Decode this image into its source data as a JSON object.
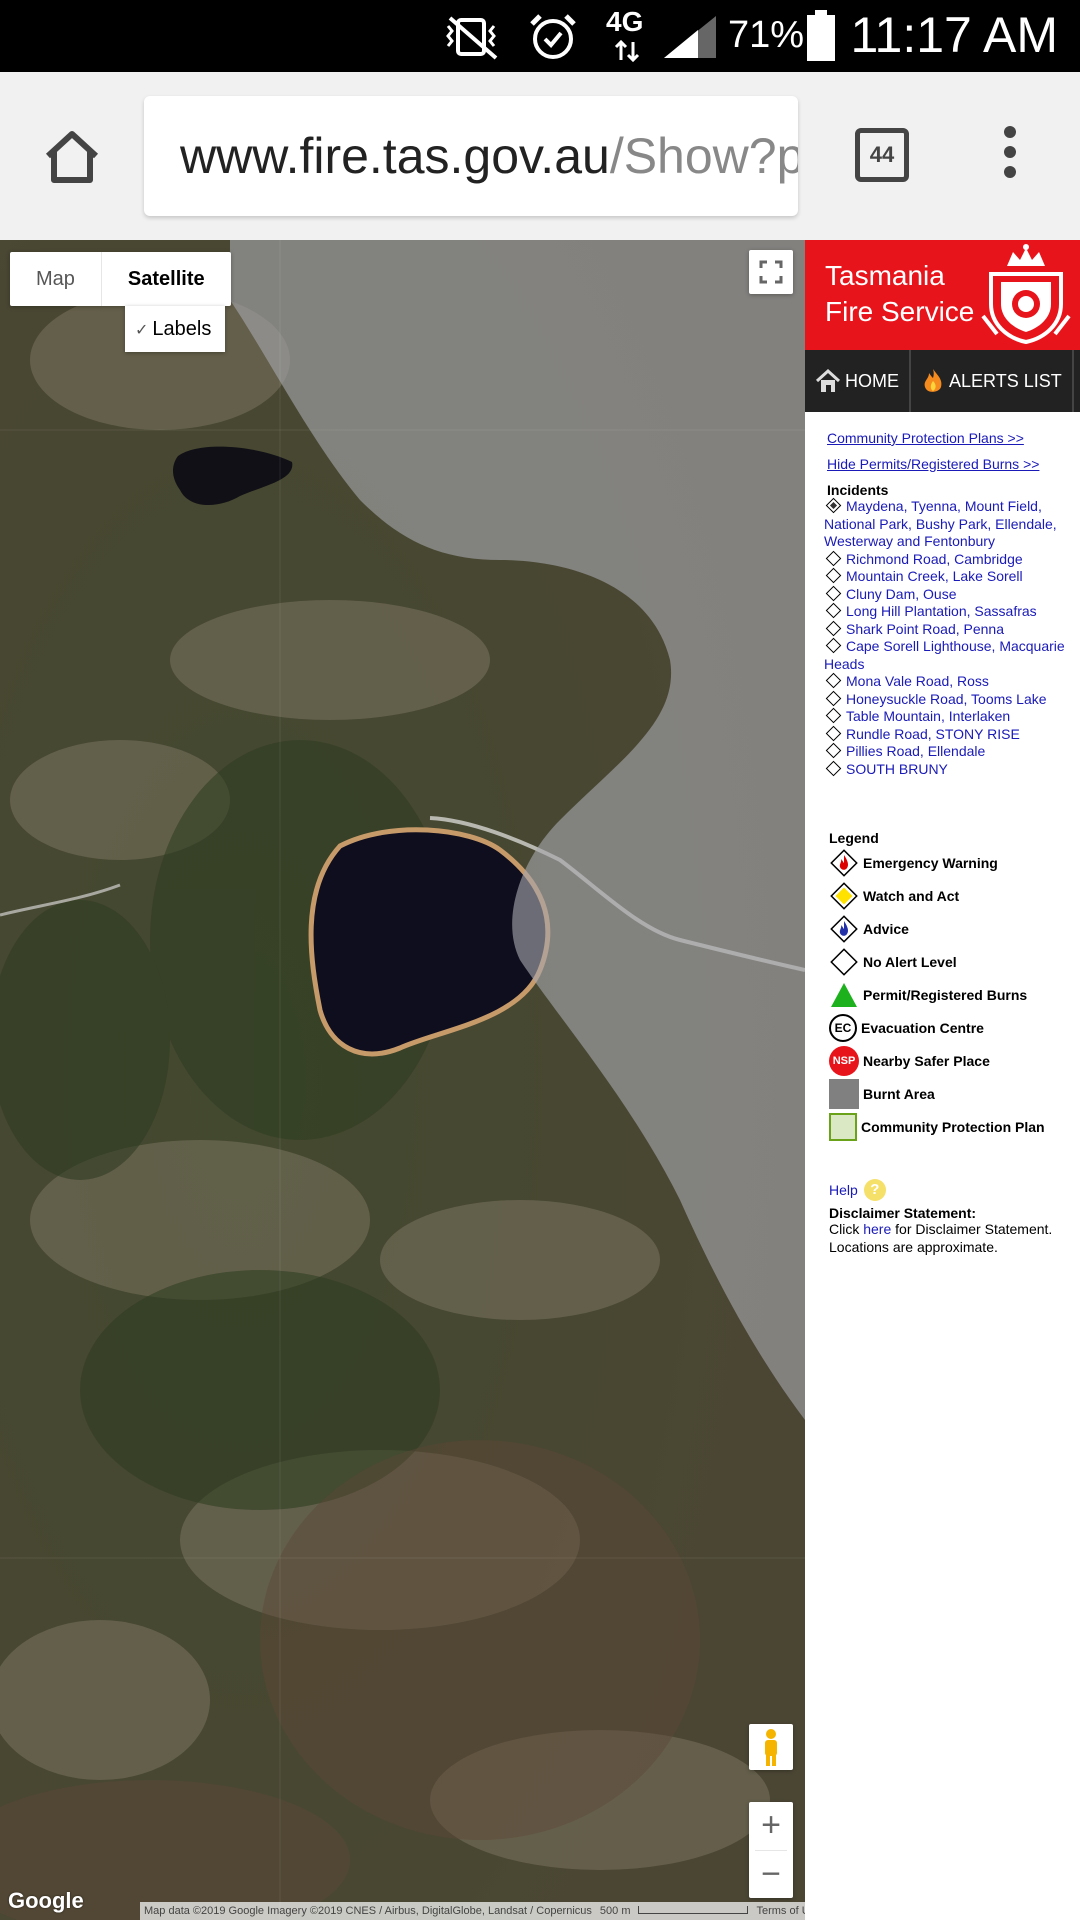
{
  "status_bar": {
    "network": "4G",
    "battery_percent": "71%",
    "time": "11:17 AM",
    "icons": [
      "vibrate-mute-icon",
      "alarm-icon",
      "signal-icon",
      "battery-icon"
    ]
  },
  "browser": {
    "url_host": "www.fire.tas.gov.au",
    "url_path": "/Show?p",
    "tab_count": "44",
    "icons": [
      "home-icon",
      "tabs-icon",
      "overflow-menu-icon"
    ]
  },
  "map": {
    "type_map_label": "Map",
    "type_satellite_label": "Satellite",
    "labels_checkbox_label": "Labels",
    "labels_checked": true,
    "zoom_in": "+",
    "zoom_out": "−",
    "google_logo": "Google",
    "attribution": "Map data ©2019 Google Imagery ©2019 CNES / Airbus, DigitalGlobe, Landsat / Copernicus",
    "scale_label": "500 m",
    "terms": "Terms of Use"
  },
  "sidebar": {
    "org_line1": "Tasmania",
    "org_line2": "Fire Service",
    "brand_color": "#e8141c",
    "nav": {
      "home": "HOME",
      "alerts": "ALERTS LIST"
    },
    "community_link": "Community Protection Plans >>",
    "permits_link": "Hide Permits/Registered Burns >>",
    "incidents_heading": "Incidents",
    "incidents": [
      "Maydena, Tyenna, Mount Field, National Park, Bushy Park, Ellendale, Westerway and Fentonbury",
      "Richmond Road, Cambridge",
      "Mountain Creek, Lake Sorell",
      "Cluny Dam, Ouse",
      "Long Hill Plantation, Sassafras",
      "Shark Point Road, Penna",
      "Cape Sorell Lighthouse, Macquarie Heads",
      "Mona Vale Road, Ross",
      "Honeysuckle Road, Tooms Lake",
      "Table Mountain, Interlaken",
      "Rundle Road, STONY RISE",
      "Pillies Road, Ellendale",
      "SOUTH BRUNY"
    ],
    "legend_heading": "Legend",
    "legend": [
      "Emergency Warning",
      "Watch and Act",
      "Advice",
      "No Alert Level",
      "Permit/Registered Burns",
      "Evacuation Centre",
      "Nearby Safer Place",
      "Burnt Area",
      "Community Protection Plan"
    ],
    "legend_badges": {
      "evac": "EC",
      "nsp": "NSP"
    },
    "help_label": "Help",
    "help_icon": "?",
    "disclaimer_heading": "Disclaimer Statement:",
    "disclaimer_pre": "Click ",
    "disclaimer_link": "here",
    "disclaimer_post": " for Disclaimer Statement.",
    "disclaimer_line2": "Locations are approximate."
  }
}
